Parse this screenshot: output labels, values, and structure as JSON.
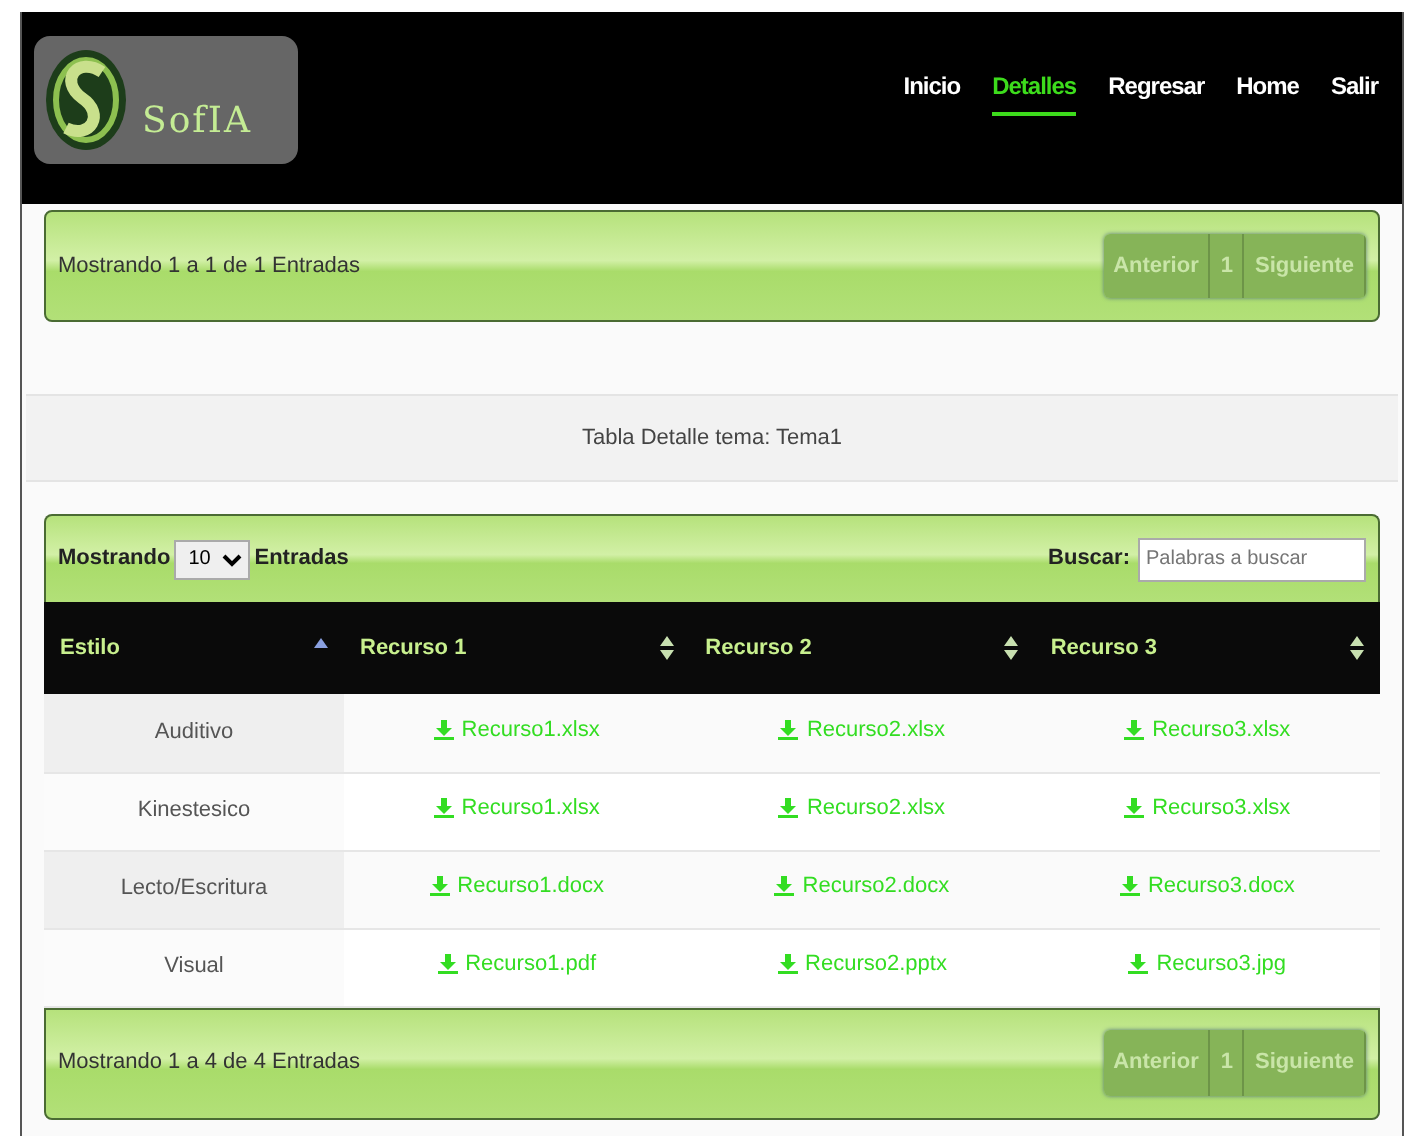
{
  "logo": {
    "text": "SofIA"
  },
  "nav": [
    {
      "label": "Inicio",
      "selected": false
    },
    {
      "label": "Detalles",
      "selected": true
    },
    {
      "label": "Regresar",
      "selected": false
    },
    {
      "label": "Home",
      "selected": false
    },
    {
      "label": "Salir",
      "selected": false
    }
  ],
  "top_bar": {
    "info": "Mostrando 1 a 1 de 1 Entradas",
    "pagination": {
      "previous": "Anterior",
      "page": "1",
      "next": "Siguiente"
    }
  },
  "caption": "Tabla Detalle tema: Tema1",
  "table_controls": {
    "show_label": "Mostrando",
    "page_size": "10",
    "entries_label": "Entradas",
    "search_label": "Buscar:",
    "search_placeholder": "Palabras a buscar"
  },
  "table": {
    "columns": [
      {
        "label": "Estilo",
        "sorted": true
      },
      {
        "label": "Recurso 1",
        "sorted": false
      },
      {
        "label": "Recurso 2",
        "sorted": false
      },
      {
        "label": "Recurso 3",
        "sorted": false
      }
    ],
    "rows": [
      {
        "estilo": "Auditivo",
        "files": [
          "Recurso1.xlsx",
          "Recurso2.xlsx",
          "Recurso3.xlsx"
        ]
      },
      {
        "estilo": "Kinestesico",
        "files": [
          "Recurso1.xlsx",
          "Recurso2.xlsx",
          "Recurso3.xlsx"
        ]
      },
      {
        "estilo": "Lecto/Escritura",
        "files": [
          "Recurso1.docx",
          "Recurso2.docx",
          "Recurso3.docx"
        ]
      },
      {
        "estilo": "Visual",
        "files": [
          "Recurso1.pdf",
          "Recurso2.pptx",
          "Recurso3.jpg"
        ]
      }
    ]
  },
  "bottom_bar": {
    "info": "Mostrando 1 a 4 de 4 Entradas",
    "pagination": {
      "previous": "Anterior",
      "page": "1",
      "next": "Siguiente"
    }
  }
}
